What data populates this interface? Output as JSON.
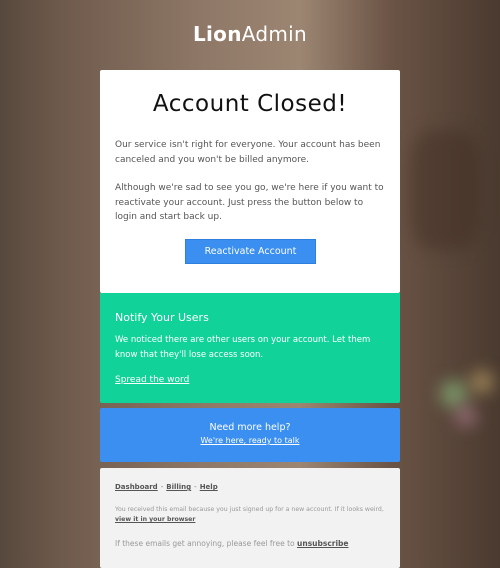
{
  "brand": {
    "bold": "Lion",
    "regular": "Admin"
  },
  "main": {
    "title": "Account Closed!",
    "paragraph1": "Our service isn't right for everyone. Your account has been canceled and you won't be billed anymore.",
    "paragraph2": "Although we're sad to see you go, we're here if you want to reactivate your account. Just press the button below to login and start back up.",
    "button_label": "Reactivate Account"
  },
  "notify": {
    "heading": "Notify Your Users",
    "text": "We noticed there are other users on your account. Let them know that they'll lose access soon.",
    "link": "Spread the word"
  },
  "help": {
    "heading": "Need more help?",
    "link": "We're here, ready to talk"
  },
  "footer": {
    "links": [
      "Dashboard",
      "Billing",
      "Help"
    ],
    "separator": "-",
    "note_prefix": "You received this email because you just signed up for a new account. If it looks weird,",
    "note_link": "view it in your browser",
    "annoy_prefix": "If these emails get annoying, please feel free to",
    "annoy_link": "unsubscribe"
  },
  "colors": {
    "accent_green": "#11d39a",
    "accent_blue": "#3a8ff0",
    "footer_bg": "#f2f2f2"
  }
}
